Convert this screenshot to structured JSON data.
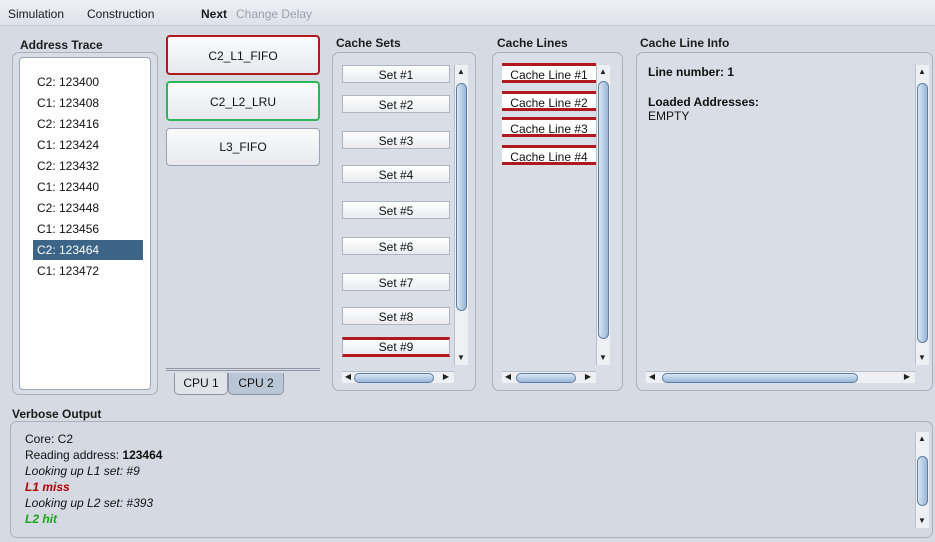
{
  "menubar": {
    "simulation": "Simulation",
    "construction": "Construction",
    "next": "Next",
    "change_delay": "Change Delay"
  },
  "address_trace": {
    "title": "Address Trace",
    "items": [
      "C2: 123400",
      "C1: 123408",
      "C2: 123416",
      "C1: 123424",
      "C2: 123432",
      "C1: 123440",
      "C2: 123448",
      "C1: 123456",
      "C2: 123464",
      "C1: 123472"
    ],
    "selected_index": 8
  },
  "cache_algorithms": {
    "buttons": [
      {
        "label": "C2_L1_FIFO",
        "border": "#b0191e"
      },
      {
        "label": "C2_L2_LRU",
        "border": "#2fb55a"
      },
      {
        "label": "L3_FIFO",
        "border": "#9aa1b0"
      }
    ],
    "tabs": [
      "CPU 1",
      "CPU 2"
    ],
    "active_tab": "CPU 2"
  },
  "cache_sets": {
    "title": "Cache Sets",
    "items": [
      "Set #1",
      "Set #2",
      "Set #3",
      "Set #4",
      "Set #5",
      "Set #6",
      "Set #7",
      "Set #8",
      "Set #9"
    ],
    "highlighted": "Set #9"
  },
  "cache_lines": {
    "title": "Cache Lines",
    "items": [
      "Cache Line #1",
      "Cache Line #2",
      "Cache Line #3",
      "Cache Line #4"
    ]
  },
  "cache_line_info": {
    "title": "Cache Line Info",
    "line_number": "Line number: 1",
    "loaded_label": "Loaded Addresses:",
    "loaded_value": "EMPTY"
  },
  "verbose": {
    "title": "Verbose Output",
    "core": "Core: C2",
    "reading_prefix": "Reading address: ",
    "reading_value": "123464",
    "lookup_l1": "Looking up L1 set: #9",
    "l1_result": "L1 miss",
    "lookup_l2": "Looking up L2 set: #393",
    "l2_result": "L2 hit"
  },
  "colors": {
    "miss": "#b30000",
    "hit": "#1fa31f",
    "selection": "#3c6487",
    "highlight_line": "#b0191e"
  }
}
